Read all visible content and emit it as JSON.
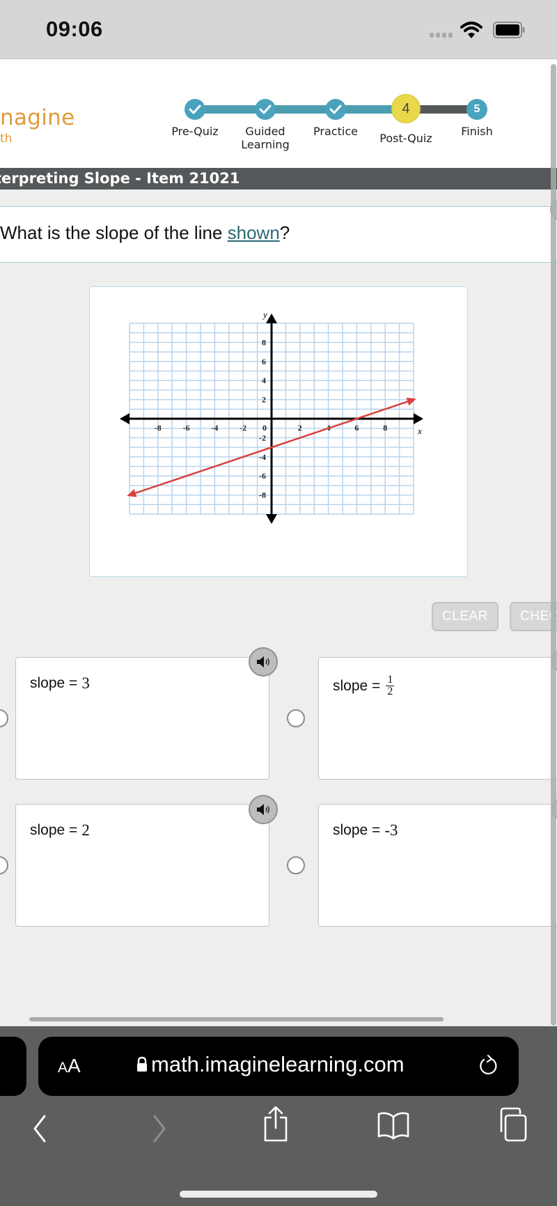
{
  "status_bar": {
    "time": "09:06",
    "icons": [
      "cellular-signal-icon",
      "wifi-icon",
      "battery-icon"
    ]
  },
  "header": {
    "logo_line1": "nagine",
    "logo_line2": "th",
    "logo_color": "#e29b3b",
    "steps": [
      {
        "label_line1": "Pre-Quiz",
        "label_line2": "",
        "state": "complete",
        "icon": "check-icon"
      },
      {
        "label_line1": "Guided",
        "label_line2": "Learning",
        "state": "complete",
        "icon": "check-icon"
      },
      {
        "label_line1": "Practice",
        "label_line2": "",
        "state": "complete",
        "icon": "check-icon"
      },
      {
        "label_line1": "Post-Quiz",
        "label_line2": "",
        "state": "current",
        "number": "4"
      },
      {
        "label_line1": "Finish",
        "label_line2": "",
        "state": "upcoming",
        "number": "5"
      }
    ],
    "colors": {
      "complete": "#4aa3bd",
      "line_complete": "#4b9eaf",
      "current": "#e8d84a",
      "line_upcoming": "#555859"
    }
  },
  "title_bar": {
    "text": "terpreting Slope - Item 21021"
  },
  "question": {
    "prefix": "What is the slope of the line ",
    "link": "shown",
    "suffix": "?"
  },
  "chart_data": {
    "type": "line",
    "title": "",
    "xlabel": "x",
    "ylabel": "y",
    "xlim": [
      -10,
      10
    ],
    "ylim": [
      -10,
      10
    ],
    "grid": true,
    "x_ticks": [
      "-8",
      "-6",
      "-4",
      "-2",
      "0",
      "2",
      "4",
      "6",
      "8"
    ],
    "y_ticks": [
      "8",
      "6",
      "4",
      "2",
      "-2",
      "-4",
      "-6",
      "-8"
    ],
    "x_tick_values": [
      -8,
      -6,
      -4,
      -2,
      0,
      2,
      4,
      6,
      8
    ],
    "y_tick_values": [
      8,
      6,
      4,
      2,
      -2,
      -4,
      -6,
      -8
    ],
    "series": [
      {
        "name": "line",
        "color": "#d9403c",
        "points": [
          [
            -10,
            -8
          ],
          [
            10,
            2
          ]
        ],
        "arrows": "both"
      }
    ],
    "key_points": [
      [
        0,
        -3
      ],
      [
        6,
        0
      ]
    ]
  },
  "buttons": {
    "clear": "CLEAR",
    "check": "CHECK"
  },
  "choices": [
    {
      "prefix": "slope = ",
      "value": "3",
      "type": "number",
      "audio": true
    },
    {
      "prefix": "slope = ",
      "numerator": "1",
      "denominator": "2",
      "type": "fraction",
      "audio": true
    },
    {
      "prefix": "slope = ",
      "value": "2",
      "type": "number",
      "audio": true
    },
    {
      "prefix": "slope = ",
      "value": "-3",
      "type": "number",
      "audio": true
    }
  ],
  "safari": {
    "text_size_label_small": "A",
    "text_size_label_large": "A",
    "url": "math.imaginelearning.com",
    "toolbar": [
      "back-icon",
      "forward-icon",
      "share-icon",
      "bookmarks-icon",
      "tabs-icon"
    ]
  }
}
